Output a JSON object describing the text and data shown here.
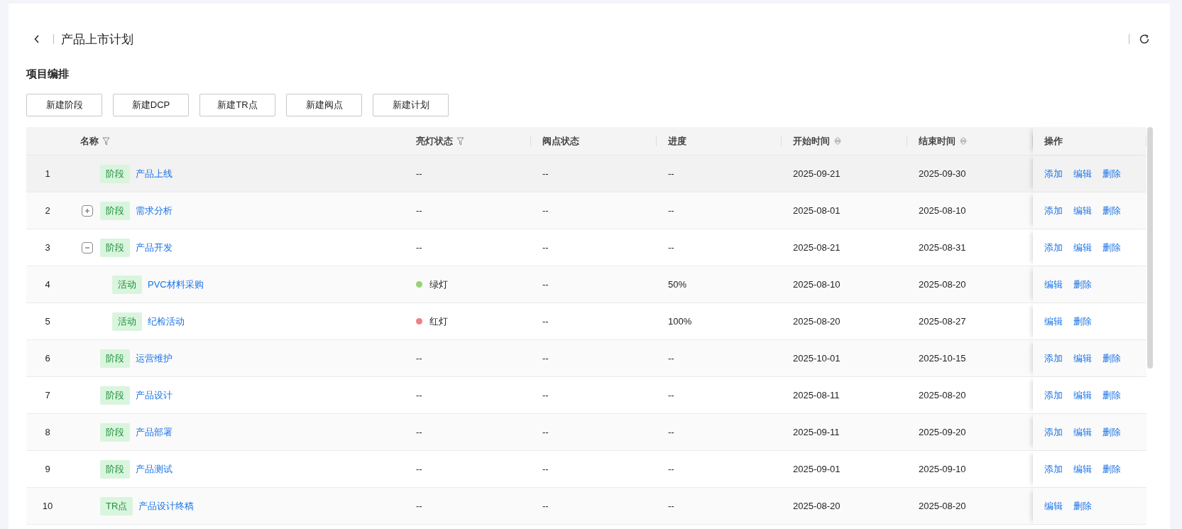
{
  "header": {
    "title": "产品上市计划"
  },
  "section": {
    "title": "项目编排"
  },
  "toolbar": [
    "新建阶段",
    "新建DCP",
    "新建TR点",
    "新建阀点",
    "新建计划"
  ],
  "table": {
    "columns": [
      {
        "label": "名称",
        "kind": "filter"
      },
      {
        "label": "亮灯状态",
        "kind": "filter"
      },
      {
        "label": "阀点状态",
        "kind": "plain"
      },
      {
        "label": "进度",
        "kind": "plain"
      },
      {
        "label": "开始时间",
        "kind": "sort"
      },
      {
        "label": "结束时间",
        "kind": "sort"
      },
      {
        "label": "操作",
        "kind": "plain"
      }
    ],
    "rows": [
      {
        "index": "1",
        "tag": "阶段",
        "name": "产品上线",
        "light": null,
        "gate": "--",
        "progress": "--",
        "start": "2025-09-21",
        "end": "2025-09-30",
        "actions": [
          "添加",
          "编辑",
          "删除"
        ],
        "hovered": true
      },
      {
        "index": "2",
        "tag": "阶段",
        "name": "需求分析",
        "expanded": false,
        "light": null,
        "gate": "--",
        "progress": "--",
        "start": "2025-08-01",
        "end": "2025-08-10",
        "actions": [
          "添加",
          "编辑",
          "删除"
        ]
      },
      {
        "index": "3",
        "tag": "阶段",
        "name": "产品开发",
        "expanded": true,
        "light": null,
        "gate": "--",
        "progress": "--",
        "start": "2025-08-21",
        "end": "2025-08-31",
        "actions": [
          "添加",
          "编辑",
          "删除"
        ],
        "children": [
          {
            "index": "4",
            "tag": "活动",
            "name": "PVC材料采购",
            "light": {
              "label": "绿灯",
              "color": "#95d475"
            },
            "gate": "--",
            "progress": "50%",
            "start": "2025-08-10",
            "end": "2025-08-20",
            "actions": [
              "编辑",
              "删除"
            ]
          },
          {
            "index": "5",
            "tag": "活动",
            "name": "纪检活动",
            "light": {
              "label": "红灯",
              "color": "#f08080"
            },
            "gate": "--",
            "progress": "100%",
            "start": "2025-08-20",
            "end": "2025-08-27",
            "actions": [
              "编辑",
              "删除"
            ]
          }
        ]
      },
      {
        "index": "6",
        "tag": "阶段",
        "name": "运营维护",
        "light": null,
        "gate": "--",
        "progress": "--",
        "start": "2025-10-01",
        "end": "2025-10-15",
        "actions": [
          "添加",
          "编辑",
          "删除"
        ]
      },
      {
        "index": "7",
        "tag": "阶段",
        "name": "产品设计",
        "light": null,
        "gate": "--",
        "progress": "--",
        "start": "2025-08-11",
        "end": "2025-08-20",
        "actions": [
          "添加",
          "编辑",
          "删除"
        ]
      },
      {
        "index": "8",
        "tag": "阶段",
        "name": "产品部署",
        "light": null,
        "gate": "--",
        "progress": "--",
        "start": "2025-09-11",
        "end": "2025-09-20",
        "actions": [
          "添加",
          "编辑",
          "删除"
        ]
      },
      {
        "index": "9",
        "tag": "阶段",
        "name": "产品测试",
        "light": null,
        "gate": "--",
        "progress": "--",
        "start": "2025-09-01",
        "end": "2025-09-10",
        "actions": [
          "添加",
          "编辑",
          "删除"
        ]
      },
      {
        "index": "10",
        "tag": "TR点",
        "name": "产品设计终稿",
        "light": null,
        "gate": "--",
        "progress": "--",
        "start": "2025-08-20",
        "end": "2025-08-20",
        "actions": [
          "编辑",
          "删除"
        ]
      }
    ],
    "empty_light": "--"
  }
}
